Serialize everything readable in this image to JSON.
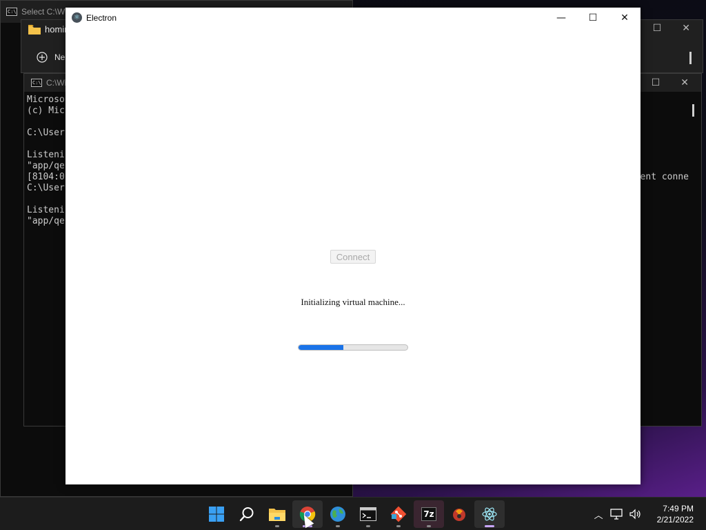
{
  "desktop": {
    "bg_window_1": {
      "title": "Select C:\\Wi"
    },
    "explorer": {
      "tab_title": "homir",
      "new_label": "Ne"
    },
    "console": {
      "title": "C:\\Wi",
      "lines": [
        "Microso",
        "(c) Mic",
        "",
        "C:\\User",
        "",
        "Listeni",
        "\"app/qe",
        "[8104:0",
        "C:\\User",
        "",
        "Listeni",
        "\"app/qe"
      ],
      "right_fragment": "ent conne"
    }
  },
  "electron": {
    "title": "Electron",
    "minimize_glyph": "—",
    "maximize_glyph": "☐",
    "close_glyph": "✕",
    "connect_label": "Connect",
    "status_text": "Initializing virtual machine...",
    "progress_fraction": 0.41,
    "progress_color": "#1a73e8"
  },
  "taskbar": {
    "apps": [
      {
        "name": "start",
        "icon": "windows-logo-icon"
      },
      {
        "name": "search",
        "icon": "search-icon"
      },
      {
        "name": "file-explorer",
        "icon": "folder-icon"
      },
      {
        "name": "chrome",
        "icon": "chrome-icon"
      },
      {
        "name": "browser",
        "icon": "globe-icon"
      },
      {
        "name": "terminal",
        "icon": "terminal-icon"
      },
      {
        "name": "git",
        "icon": "git-icon"
      },
      {
        "name": "7zip",
        "icon": "7zip-icon",
        "label": "7z"
      },
      {
        "name": "app",
        "icon": "app-icon"
      },
      {
        "name": "electron",
        "icon": "electron-icon"
      }
    ],
    "time": "7:49 PM",
    "date": "2/21/2022"
  }
}
